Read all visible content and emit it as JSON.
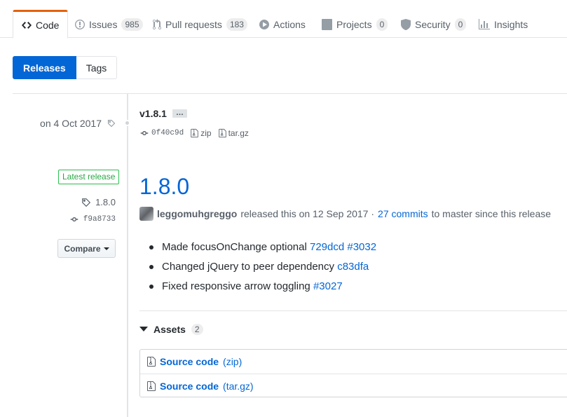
{
  "tabs": [
    {
      "label": "Code",
      "icon": "code-icon"
    },
    {
      "label": "Issues",
      "count": "985",
      "icon": "issue-icon"
    },
    {
      "label": "Pull requests",
      "count": "183",
      "icon": "pull-request-icon"
    },
    {
      "label": "Actions",
      "icon": "play-icon"
    },
    {
      "label": "Projects",
      "count": "0",
      "icon": "project-icon"
    },
    {
      "label": "Security",
      "count": "0",
      "icon": "shield-icon"
    },
    {
      "label": "Insights",
      "icon": "graph-icon"
    }
  ],
  "subnav": {
    "releases": "Releases",
    "tags": "Tags"
  },
  "older_release": {
    "date": "on 4 Oct 2017",
    "name": "v1.8.1",
    "ellipsis": "…",
    "commit": "0f40c9d",
    "zip": "zip",
    "targz": "tar.gz"
  },
  "release": {
    "badge": "Latest release",
    "tag": "1.8.0",
    "commit": "f9a8733",
    "compare": "Compare",
    "title": "1.8.0",
    "author": "leggomuhgreggo",
    "released_text": "released this on 12 Sep 2017 ·",
    "commits_link": "27 commits",
    "since_text": "to master since this release",
    "notes": [
      {
        "text": "Made focusOnChange optional",
        "refs": [
          "729dcd",
          "#3032"
        ]
      },
      {
        "text": "Changed jQuery to peer dependency",
        "refs": [
          "c83dfa"
        ]
      },
      {
        "text": "Fixed responsive arrow toggling",
        "refs": [
          "#3027"
        ]
      }
    ],
    "assets_label": "Assets",
    "assets_count": "2",
    "assets": [
      {
        "name": "Source code",
        "ext": "(zip)"
      },
      {
        "name": "Source code",
        "ext": "(tar.gz)"
      }
    ]
  },
  "colors": {
    "accent": "#e36209",
    "link": "#0366d6",
    "badge_green": "#28a745"
  }
}
